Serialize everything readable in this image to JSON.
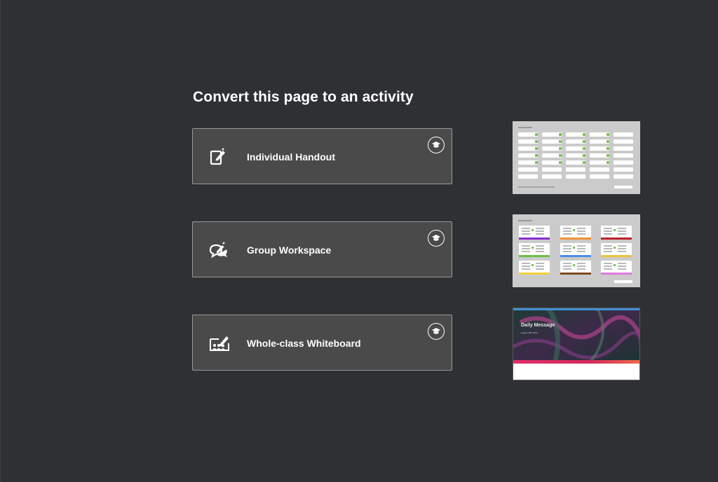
{
  "title": "Convert this page to an activity",
  "options": [
    {
      "label": "Individual Handout",
      "icon": "edit-note-icon",
      "badge_icon": "graduation-cap-icon",
      "thumbnail": "handout-grid-thumbnail"
    },
    {
      "label": "Group Workspace",
      "icon": "chat-pencil-icon",
      "badge_icon": "graduation-cap-icon",
      "thumbnail": "group-cards-thumbnail"
    },
    {
      "label": "Whole-class Whiteboard",
      "icon": "whiteboard-icon",
      "badge_icon": "graduation-cap-icon",
      "thumbnail": "daily-message-thumbnail"
    }
  ],
  "thumbnails": {
    "daily_message": {
      "title": "Daily Message",
      "subtitle": "August 19th 2024"
    }
  },
  "colors": {
    "background": "#2e3033",
    "card": "#4a4a4a",
    "card_border": "#9a9a9a",
    "text": "#ffffff",
    "check_green": "#7cc04b",
    "group_card_bars": [
      "#8a2ecf",
      "#f0913a",
      "#c0202f",
      "#6ac046",
      "#4a8ee0",
      "#f3c23a",
      "#f2d23a",
      "#7a4a20",
      "#e07adf"
    ]
  }
}
